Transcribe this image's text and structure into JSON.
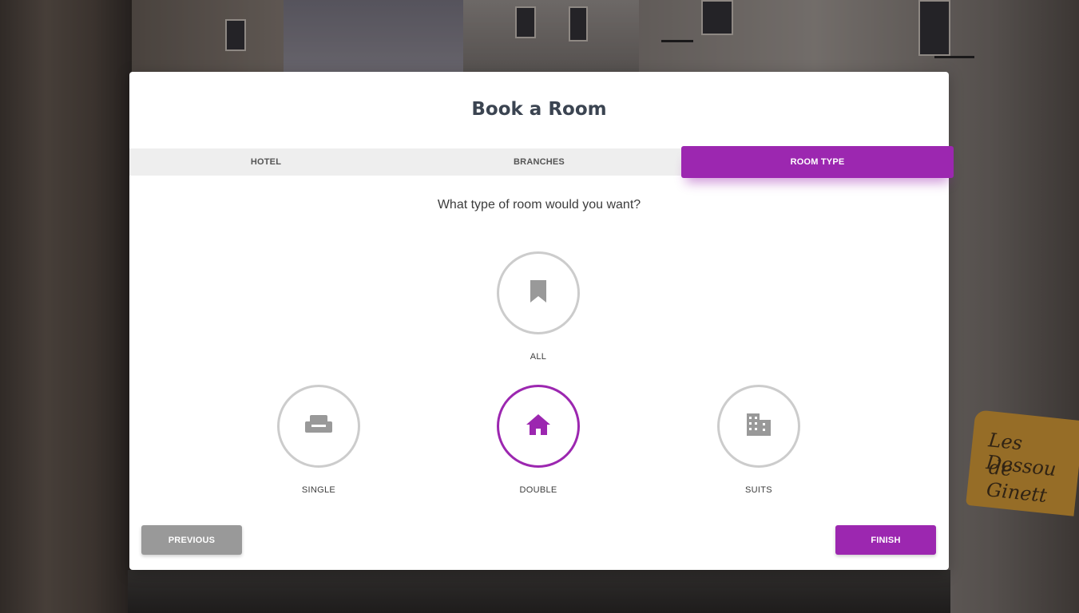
{
  "card": {
    "title": "Book a Room"
  },
  "tabs": [
    {
      "label": "HOTEL",
      "active": false
    },
    {
      "label": "BRANCHES",
      "active": false
    },
    {
      "label": "ROOM TYPE",
      "active": true
    }
  ],
  "question": "What type of room would you want?",
  "options": [
    {
      "label": "ALL",
      "icon": "bookmark-icon",
      "selected": false
    },
    {
      "label": "SINGLE",
      "icon": "sofa-icon",
      "selected": false
    },
    {
      "label": "DOUBLE",
      "icon": "home-icon",
      "selected": true
    },
    {
      "label": "SUITS",
      "icon": "building-icon",
      "selected": false
    }
  ],
  "buttons": {
    "previous": "PREVIOUS",
    "finish": "FINISH"
  },
  "background": {
    "sign_line1": "Les Dessou",
    "sign_line2": "de Ginett"
  },
  "colors": {
    "accent": "#9c27b0",
    "inactive_icon": "#999999",
    "inactive_border": "#cccccc",
    "previous_button": "#999999",
    "title_text": "#3b4451"
  }
}
